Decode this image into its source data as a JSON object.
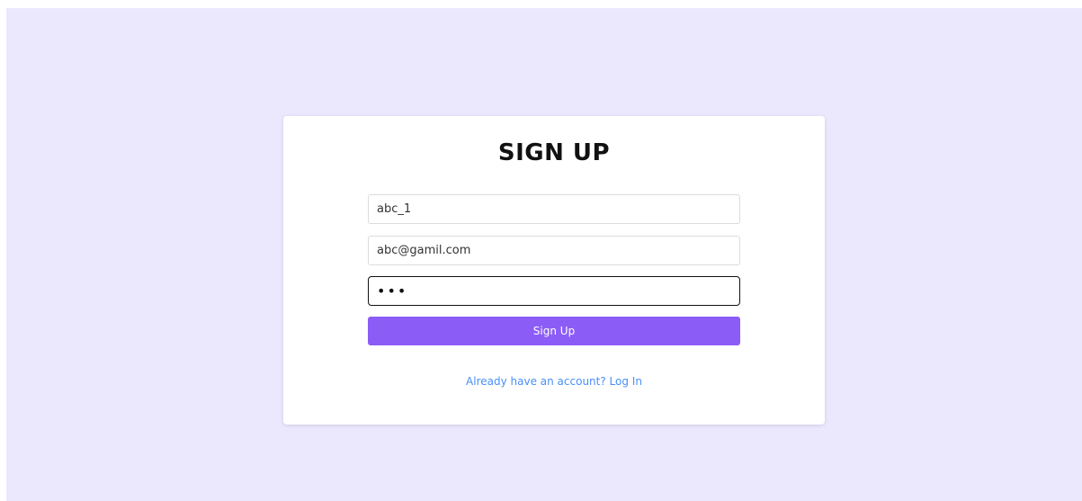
{
  "form": {
    "title": "SIGN UP",
    "username_value": "abc_1",
    "email_value": "abc@gamil.com",
    "password_value": "abc",
    "submit_label": "Sign Up",
    "login_link_label": "Already have an account? Log In"
  },
  "colors": {
    "page_background": "#ebe8fd",
    "button": "#8c5cf7",
    "link": "#4a8ff7"
  }
}
